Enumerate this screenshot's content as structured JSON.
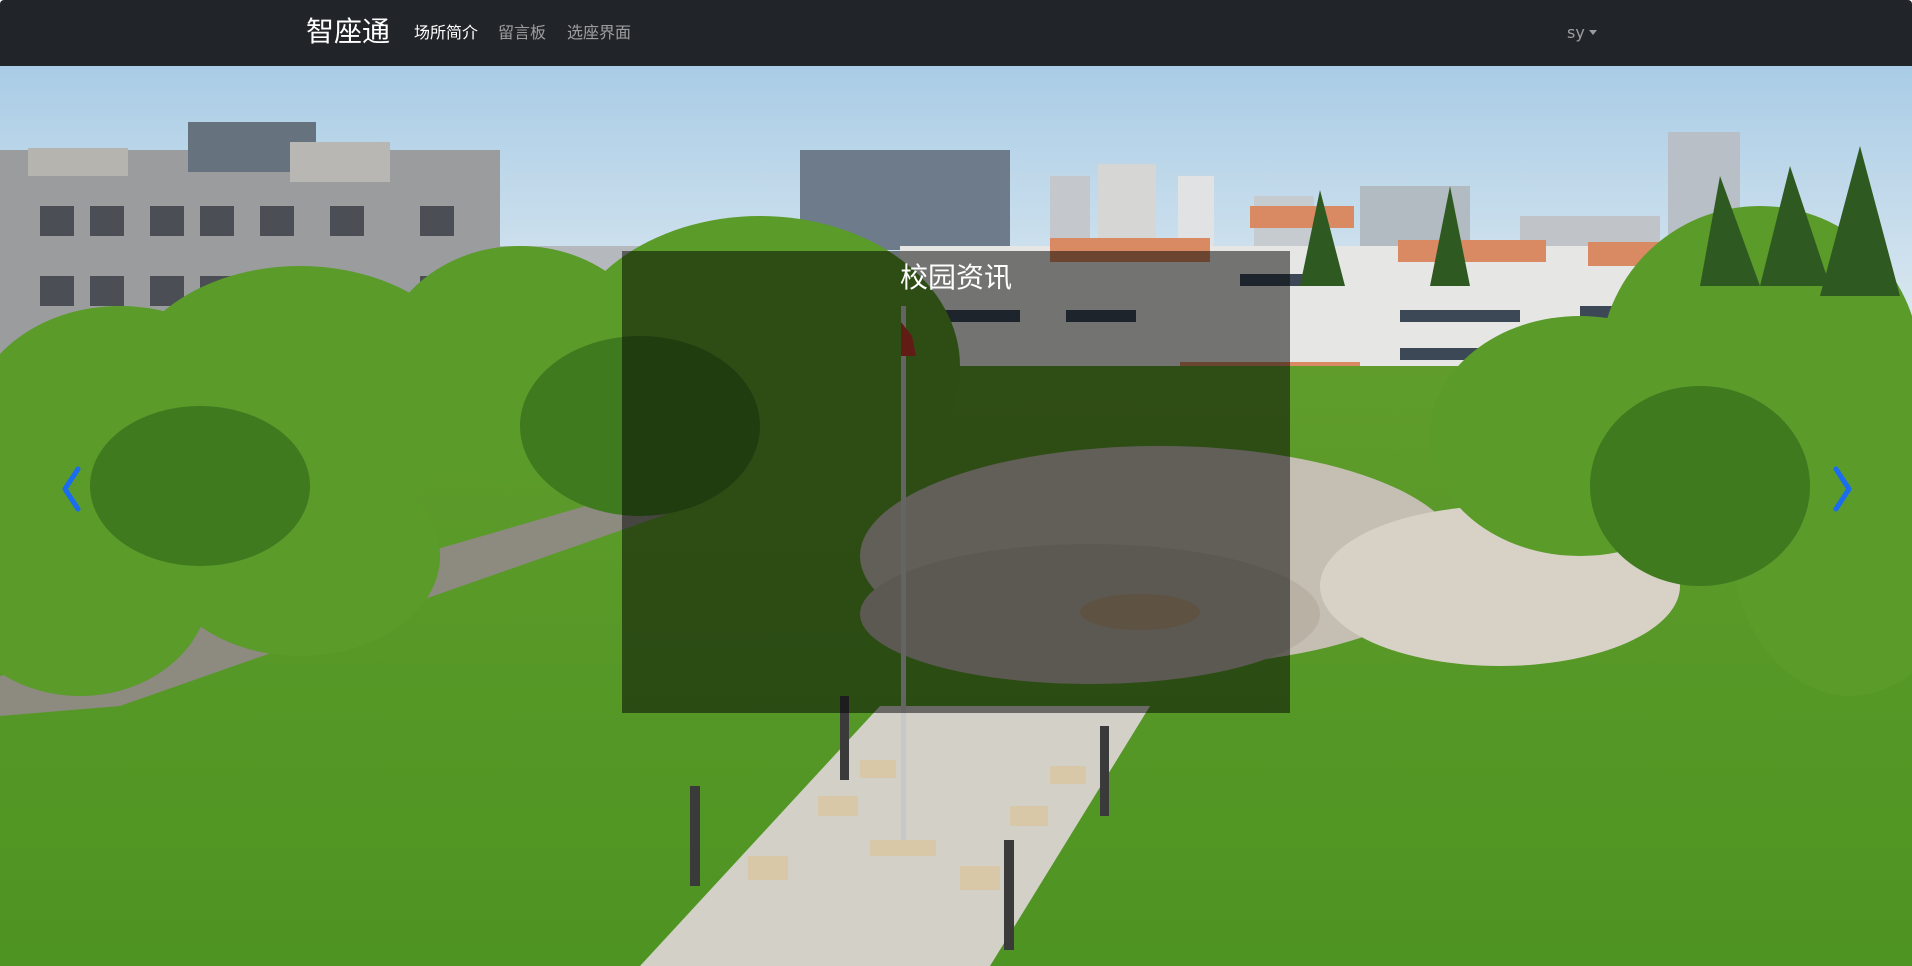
{
  "navbar": {
    "brand": "智座通",
    "links": [
      {
        "label": "场所简介",
        "active": true
      },
      {
        "label": "留言板",
        "active": false
      },
      {
        "label": "选座界面",
        "active": false
      }
    ],
    "user": "sy",
    "user_menu_icon": "caret-down-icon"
  },
  "carousel": {
    "slide": {
      "image": "campus aerial photo: library building, plaza, green lawns",
      "caption": "校园资讯"
    },
    "prev_icon": "chevron-left-icon",
    "next_icon": "chevron-right-icon"
  },
  "colors": {
    "navbar_bg": "#212529",
    "nav_active": "#ffffff",
    "nav_inactive": "rgba(255,255,255,0.55)",
    "carousel_control": "#1a6cf0",
    "caption_overlay": "rgba(0,0,0,0.5)"
  }
}
